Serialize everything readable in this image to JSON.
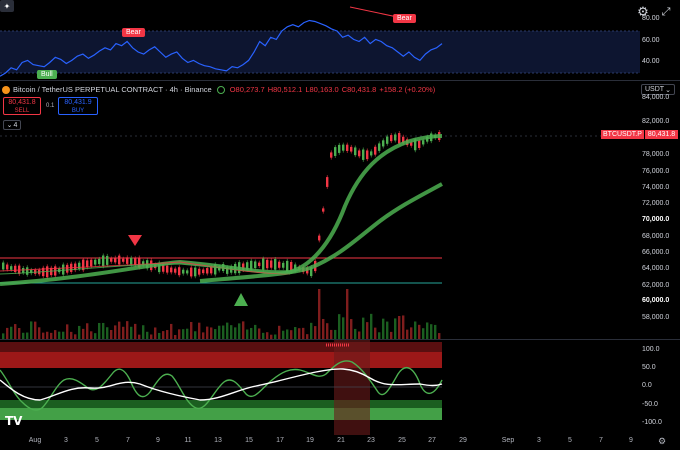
{
  "toolbar": {
    "settings_icon": "gear-icon",
    "fullscreen_icon": "expand-icon",
    "star_icon": "sparkle-icon"
  },
  "rsi_pane": {
    "axis_ticks": [
      "80.00",
      "60.00",
      "40.00"
    ],
    "labels": [
      {
        "text": "Bull",
        "type": "bull"
      },
      {
        "text": "Bear",
        "type": "bear"
      },
      {
        "text": "Bear",
        "type": "bear"
      }
    ],
    "values": [
      37,
      40,
      45,
      43,
      50,
      52,
      48,
      47,
      46,
      50,
      55,
      53,
      49,
      52,
      56,
      58,
      54,
      57,
      61,
      64,
      62,
      68,
      66,
      70,
      64,
      60,
      58,
      62,
      65,
      60,
      55,
      58,
      60,
      54,
      50,
      52,
      49,
      47,
      46,
      44,
      43,
      42,
      46,
      45,
      48,
      52,
      60,
      70,
      66,
      74,
      72,
      80,
      84,
      86,
      84,
      88,
      90,
      89,
      87,
      85,
      82,
      80,
      74,
      76,
      72,
      70,
      74,
      68,
      72,
      70,
      66,
      64,
      60,
      56,
      60,
      55,
      52,
      58,
      62,
      64,
      68
    ]
  },
  "symbol_bar": {
    "title": "Bitcoin / TetherUS PERPETUAL CONTRACT · 4h · Binance",
    "open": "O80,273.7",
    "high": "H80,512.1",
    "low": "L80,163.0",
    "close": "C80,431.8",
    "change": "+158.2 (+0.20%)",
    "currency": "USDT"
  },
  "trade_boxes": {
    "sell_price": "80,431.8",
    "sell_label": "SELL",
    "spread": "0.1",
    "buy_price": "80,431.9",
    "buy_label": "BUY"
  },
  "indicators_collapsed": "4",
  "price_axis": {
    "ticks": [
      "84,000.0",
      "82,000.0",
      "78,000.0",
      "76,000.0",
      "74,000.0",
      "72,000.0",
      "70,000.0",
      "68,000.0",
      "66,000.0",
      "64,000.0",
      "62,000.0",
      "60,000.0",
      "58,000.0"
    ],
    "symbol_tag": "BTCUSDT.P",
    "current_price": "80,431.8"
  },
  "oscillator_pane": {
    "axis_ticks": [
      "100.0",
      "50.0",
      "0.0",
      "-50.0",
      "-100.0"
    ]
  },
  "time_axis": {
    "ticks": [
      "Aug",
      "3",
      "5",
      "7",
      "9",
      "11",
      "13",
      "15",
      "17",
      "19",
      "21",
      "23",
      "25",
      "27",
      "29",
      "Sep",
      "3",
      "5",
      "7",
      "9"
    ]
  },
  "colors": {
    "bull_green": "#4caf50",
    "bear_red": "#f23645",
    "rsi_blue": "#2962ff",
    "background": "#000000"
  },
  "logo": "TV"
}
